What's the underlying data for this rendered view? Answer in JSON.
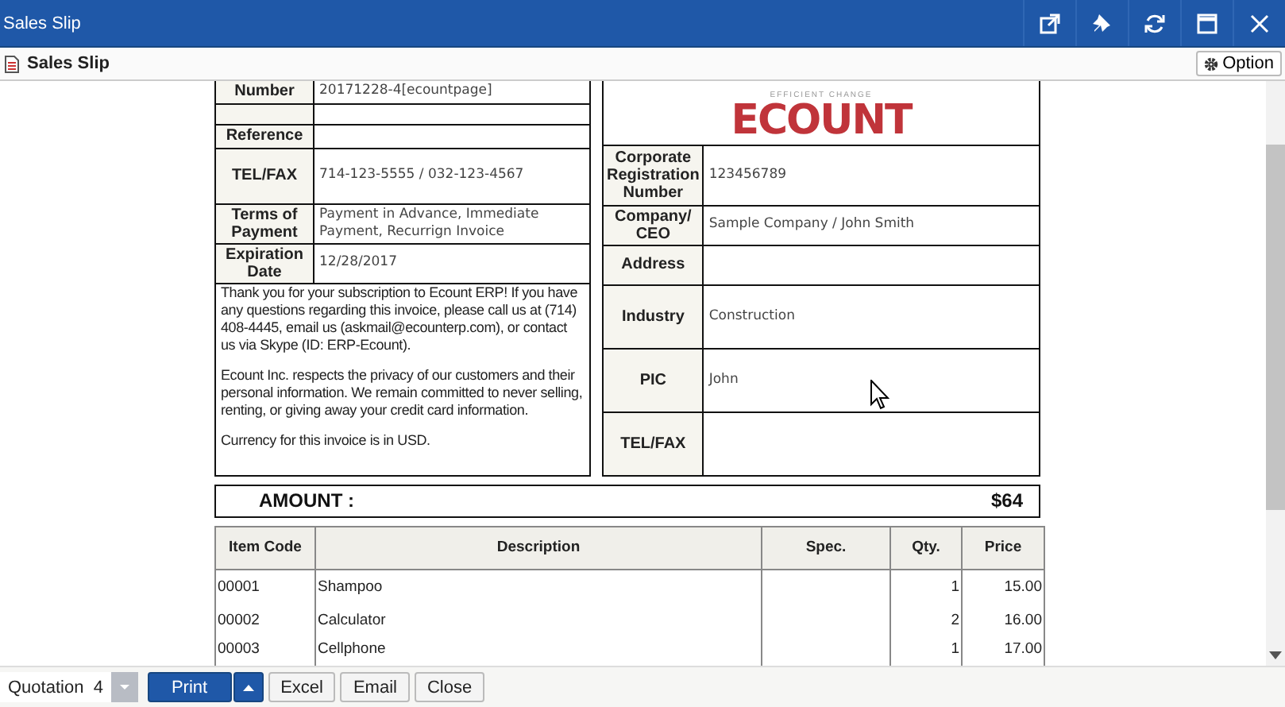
{
  "window": {
    "title": "Sales Slip"
  },
  "toolbar": {
    "title": "Sales Slip",
    "option": "Option"
  },
  "left_table": {
    "rows": [
      {
        "label": "Number",
        "value": "20171228-4[ecountpage]"
      },
      {},
      {
        "label": "Reference"
      },
      {
        "label": "TEL/FAX",
        "value": "714-123-5555  /  032-123-4567"
      },
      {
        "label": "Terms of Payment",
        "value": "Payment in Advance, Immediate Payment, Recurrign Invoice"
      },
      {
        "label": "Expiration Date",
        "value": "12/28/2017"
      }
    ],
    "notes": [
      "Thank you for your subscription to Ecount ERP! If you have any questions regarding this invoice, please call us at (714) 408-4445, email us (askmail@ecounterp.com), or contact us via Skype (ID: ERP-Ecount).",
      "Ecount Inc. respects the privacy of our customers and their personal information. We remain committed to never selling, renting, or giving away your credit card information.",
      "Currency for this invoice is in USD."
    ]
  },
  "right_table": {
    "logo": {
      "tagline": "EFFICIENT CHANGE",
      "name": "ECOUNT"
    },
    "rows": [
      {
        "label": "Corporate Registration Number",
        "value": "123456789"
      },
      {
        "label": "Company/ CEO",
        "value": "Sample Company / John Smith"
      },
      {
        "label": "Address"
      },
      {
        "label": "Industry",
        "value": "Construction"
      },
      {
        "label": "PIC",
        "value": "John"
      },
      {
        "label": "TEL/FAX"
      }
    ]
  },
  "amount": {
    "label": "AMOUNT :",
    "value": "$64"
  },
  "items": {
    "columns": [
      "Item Code",
      "Description",
      "Spec.",
      "Qty.",
      "Price"
    ],
    "rows": [
      {
        "item_code": "00001",
        "description": "Shampoo",
        "qty": "1",
        "price": "15.00"
      },
      {
        "item_code": "00002",
        "description": "Calculator",
        "qty": "2",
        "price": "16.00"
      },
      {
        "item_code": "00003",
        "description": "Cellphone",
        "qty": "1",
        "price": "17.00"
      }
    ]
  },
  "footer": {
    "form_select": "Quotation  4",
    "buttons": [
      {
        "kind": "primary",
        "label": "Print"
      },
      {
        "kind": "plain",
        "label": "Excel"
      },
      {
        "kind": "plain",
        "label": "Email"
      },
      {
        "kind": "plain",
        "label": "Close"
      }
    ]
  }
}
